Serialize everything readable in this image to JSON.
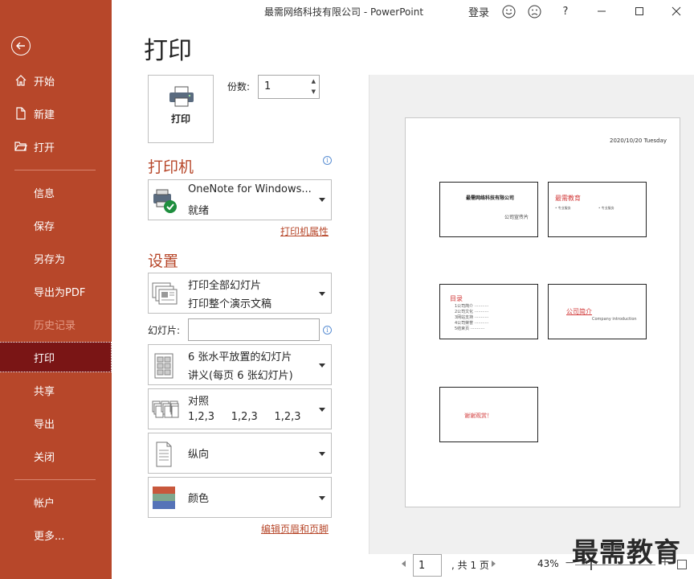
{
  "window": {
    "title": "最需网络科技有限公司  -  PowerPoint",
    "login": "登录"
  },
  "sidebar": {
    "items": [
      {
        "label": "开始"
      },
      {
        "label": "新建"
      },
      {
        "label": "打开"
      },
      {
        "label": "信息"
      },
      {
        "label": "保存"
      },
      {
        "label": "另存为"
      },
      {
        "label": "导出为PDF"
      },
      {
        "label": "历史记录"
      },
      {
        "label": "打印"
      },
      {
        "label": "共享"
      },
      {
        "label": "导出"
      },
      {
        "label": "关闭"
      },
      {
        "label": "帐户"
      },
      {
        "label": "更多..."
      }
    ]
  },
  "page": {
    "heading": "打印"
  },
  "print": {
    "button_label": "打印",
    "copies_label": "份数:",
    "copies_value": "1"
  },
  "printer": {
    "section_title": "打印机",
    "name": "OneNote for Windows...",
    "status": "就绪",
    "properties_link": "打印机属性"
  },
  "settings": {
    "section_title": "设置",
    "range": {
      "line1": "打印全部幻灯片",
      "line2": "打印整个演示文稿"
    },
    "slides_label": "幻灯片:",
    "slides_value": "",
    "layout": {
      "line1": "6 张水平放置的幻灯片",
      "line2": "讲义(每页 6 张幻灯片)"
    },
    "collation": {
      "line1": "对照",
      "line2": "1,2,3     1,2,3     1,2,3"
    },
    "orientation": {
      "line1": "纵向"
    },
    "color": {
      "line1": "颜色"
    },
    "header_footer_link": "编辑页眉和页脚"
  },
  "preview": {
    "date": "2020/10/20 Tuesday",
    "slide1": {
      "title": "最需网络科技有限公司",
      "subtitle": "公司宣传片"
    },
    "slide2": {
      "title": "最需教育",
      "left": "• 专业服务",
      "right": "• 专业服务"
    },
    "slide3": {
      "title": "目录",
      "items": [
        "1公司简介 ···········",
        "2公司文化 ···········",
        "3网站支持 ···········",
        "4公司荣誉 ···········",
        "5结束页 ···········"
      ]
    },
    "slide4": {
      "title": "公司简介",
      "subtitle": "Company introduction"
    },
    "slide5": {
      "title": "谢谢观赏！"
    }
  },
  "pager": {
    "current": "1",
    "total": ", 共 1 页",
    "zoom": "43%"
  },
  "watermark": "最需教育",
  "colors": {
    "accent": "#b7472a",
    "active_nav": "#7a1515"
  }
}
